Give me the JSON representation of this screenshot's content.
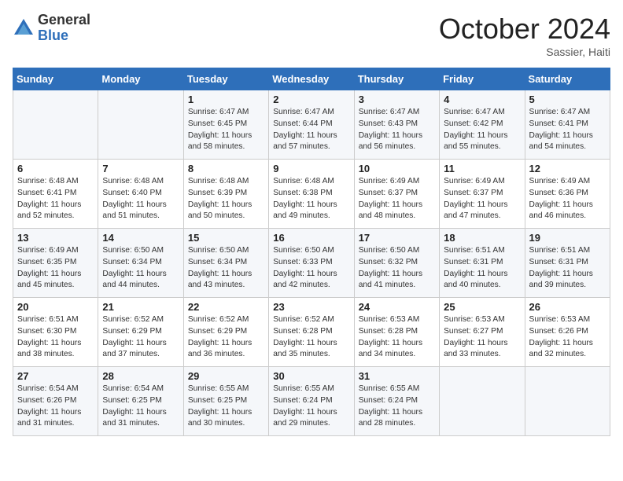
{
  "logo": {
    "general": "General",
    "blue": "Blue"
  },
  "title": "October 2024",
  "location": "Sassier, Haiti",
  "days_of_week": [
    "Sunday",
    "Monday",
    "Tuesday",
    "Wednesday",
    "Thursday",
    "Friday",
    "Saturday"
  ],
  "weeks": [
    [
      {
        "day": "",
        "info": ""
      },
      {
        "day": "",
        "info": ""
      },
      {
        "day": "1",
        "info": "Sunrise: 6:47 AM\nSunset: 6:45 PM\nDaylight: 11 hours and 58 minutes."
      },
      {
        "day": "2",
        "info": "Sunrise: 6:47 AM\nSunset: 6:44 PM\nDaylight: 11 hours and 57 minutes."
      },
      {
        "day": "3",
        "info": "Sunrise: 6:47 AM\nSunset: 6:43 PM\nDaylight: 11 hours and 56 minutes."
      },
      {
        "day": "4",
        "info": "Sunrise: 6:47 AM\nSunset: 6:42 PM\nDaylight: 11 hours and 55 minutes."
      },
      {
        "day": "5",
        "info": "Sunrise: 6:47 AM\nSunset: 6:41 PM\nDaylight: 11 hours and 54 minutes."
      }
    ],
    [
      {
        "day": "6",
        "info": "Sunrise: 6:48 AM\nSunset: 6:41 PM\nDaylight: 11 hours and 52 minutes."
      },
      {
        "day": "7",
        "info": "Sunrise: 6:48 AM\nSunset: 6:40 PM\nDaylight: 11 hours and 51 minutes."
      },
      {
        "day": "8",
        "info": "Sunrise: 6:48 AM\nSunset: 6:39 PM\nDaylight: 11 hours and 50 minutes."
      },
      {
        "day": "9",
        "info": "Sunrise: 6:48 AM\nSunset: 6:38 PM\nDaylight: 11 hours and 49 minutes."
      },
      {
        "day": "10",
        "info": "Sunrise: 6:49 AM\nSunset: 6:37 PM\nDaylight: 11 hours and 48 minutes."
      },
      {
        "day": "11",
        "info": "Sunrise: 6:49 AM\nSunset: 6:37 PM\nDaylight: 11 hours and 47 minutes."
      },
      {
        "day": "12",
        "info": "Sunrise: 6:49 AM\nSunset: 6:36 PM\nDaylight: 11 hours and 46 minutes."
      }
    ],
    [
      {
        "day": "13",
        "info": "Sunrise: 6:49 AM\nSunset: 6:35 PM\nDaylight: 11 hours and 45 minutes."
      },
      {
        "day": "14",
        "info": "Sunrise: 6:50 AM\nSunset: 6:34 PM\nDaylight: 11 hours and 44 minutes."
      },
      {
        "day": "15",
        "info": "Sunrise: 6:50 AM\nSunset: 6:34 PM\nDaylight: 11 hours and 43 minutes."
      },
      {
        "day": "16",
        "info": "Sunrise: 6:50 AM\nSunset: 6:33 PM\nDaylight: 11 hours and 42 minutes."
      },
      {
        "day": "17",
        "info": "Sunrise: 6:50 AM\nSunset: 6:32 PM\nDaylight: 11 hours and 41 minutes."
      },
      {
        "day": "18",
        "info": "Sunrise: 6:51 AM\nSunset: 6:31 PM\nDaylight: 11 hours and 40 minutes."
      },
      {
        "day": "19",
        "info": "Sunrise: 6:51 AM\nSunset: 6:31 PM\nDaylight: 11 hours and 39 minutes."
      }
    ],
    [
      {
        "day": "20",
        "info": "Sunrise: 6:51 AM\nSunset: 6:30 PM\nDaylight: 11 hours and 38 minutes."
      },
      {
        "day": "21",
        "info": "Sunrise: 6:52 AM\nSunset: 6:29 PM\nDaylight: 11 hours and 37 minutes."
      },
      {
        "day": "22",
        "info": "Sunrise: 6:52 AM\nSunset: 6:29 PM\nDaylight: 11 hours and 36 minutes."
      },
      {
        "day": "23",
        "info": "Sunrise: 6:52 AM\nSunset: 6:28 PM\nDaylight: 11 hours and 35 minutes."
      },
      {
        "day": "24",
        "info": "Sunrise: 6:53 AM\nSunset: 6:28 PM\nDaylight: 11 hours and 34 minutes."
      },
      {
        "day": "25",
        "info": "Sunrise: 6:53 AM\nSunset: 6:27 PM\nDaylight: 11 hours and 33 minutes."
      },
      {
        "day": "26",
        "info": "Sunrise: 6:53 AM\nSunset: 6:26 PM\nDaylight: 11 hours and 32 minutes."
      }
    ],
    [
      {
        "day": "27",
        "info": "Sunrise: 6:54 AM\nSunset: 6:26 PM\nDaylight: 11 hours and 31 minutes."
      },
      {
        "day": "28",
        "info": "Sunrise: 6:54 AM\nSunset: 6:25 PM\nDaylight: 11 hours and 31 minutes."
      },
      {
        "day": "29",
        "info": "Sunrise: 6:55 AM\nSunset: 6:25 PM\nDaylight: 11 hours and 30 minutes."
      },
      {
        "day": "30",
        "info": "Sunrise: 6:55 AM\nSunset: 6:24 PM\nDaylight: 11 hours and 29 minutes."
      },
      {
        "day": "31",
        "info": "Sunrise: 6:55 AM\nSunset: 6:24 PM\nDaylight: 11 hours and 28 minutes."
      },
      {
        "day": "",
        "info": ""
      },
      {
        "day": "",
        "info": ""
      }
    ]
  ]
}
